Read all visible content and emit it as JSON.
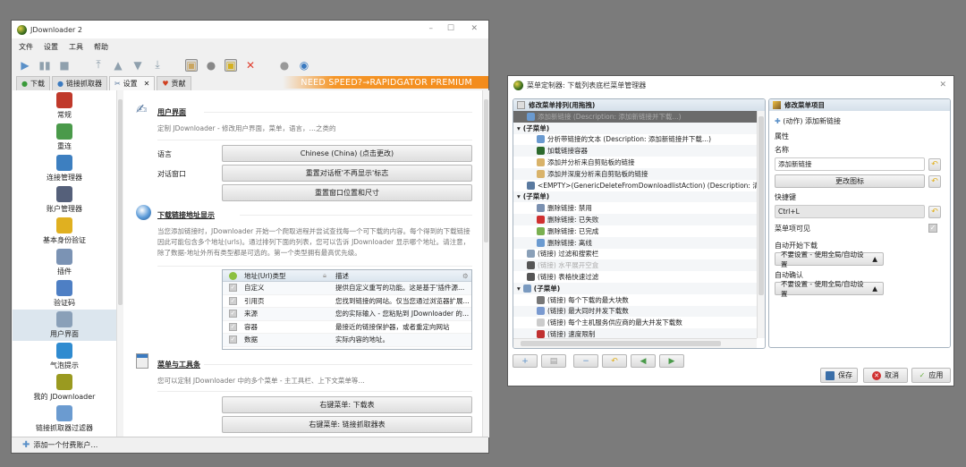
{
  "main_window": {
    "title": "JDownloader 2",
    "window_controls": [
      "–",
      "☐",
      "✕"
    ],
    "menu": [
      "文件",
      "设置",
      "工具",
      "帮助"
    ],
    "tabs": [
      {
        "label": "下载",
        "icon": "download-icon"
      },
      {
        "label": "链接抓取器",
        "icon": "linkgrabber-icon"
      },
      {
        "label": "设置",
        "icon": "settings-icon",
        "closable": true,
        "close": "✕"
      },
      {
        "label": "贡献",
        "icon": "heart-icon"
      }
    ],
    "promo": "NEED SPEED?→RAPIDGATOR PREMIUM",
    "sidebar": [
      {
        "label": "常规",
        "color": "#c0392b"
      },
      {
        "label": "重连",
        "color": "#4a9a4a"
      },
      {
        "label": "连接管理器",
        "color": "#3d7fc0"
      },
      {
        "label": "账户管理器",
        "color": "#55607a"
      },
      {
        "label": "基本身份验证",
        "color": "#e0b020"
      },
      {
        "label": "插件",
        "color": "#7b93b4"
      },
      {
        "label": "验证码",
        "color": "#4e7fc4"
      },
      {
        "label": "用户界面",
        "color": "#8aa0b8",
        "selected": true
      },
      {
        "label": "气泡提示",
        "color": "#2f8bd0"
      },
      {
        "label": "我的 JDownloader",
        "color": "#9a9a20"
      },
      {
        "label": "链接抓取器过滤器",
        "color": "#6b9bd0"
      }
    ],
    "ui_section": {
      "title": "用户界面",
      "desc": "定制 JDownloader - 修改用户界面，菜单，语言，…之类的",
      "language_label": "语言",
      "language_value": "Chinese (China) (点击更改)",
      "dialog_label": "对话窗口",
      "reset_dialog": "重置对话框'不再显示'标志",
      "reset_window": "重置窗口位置和尺寸"
    },
    "url_section": {
      "title": "下载链接地址显示",
      "desc": "当您添加链接时，JDownloader 开始一个爬取进程并尝试查找每一个可下载的内容。每个得到的下载链接因此可能包含多个地址(urls)。通过排列下面的列表，您可以告诉 JDownloader 显示哪个地址。请注意，除了数据-地址外所有类型都是可选的。第一个类型拥有最高优先级。",
      "columns": [
        "地址(Url)类型",
        "描述"
      ],
      "rows": [
        {
          "type": "自定义",
          "desc": "提供自定义重写的功能。这是基于'插件源..."
        },
        {
          "type": "引用页",
          "desc": "您找到链接的网站。仅当您通过浏览器扩展..."
        },
        {
          "type": "来源",
          "desc": "您的实际输入 - 您粘贴到 JDownloader 的..."
        },
        {
          "type": "容器",
          "desc": "最接近的链接保护器，或者重定向网站"
        },
        {
          "type": "数据",
          "desc": "实际内容的地址。"
        }
      ]
    },
    "menu_section": {
      "title": "菜单与工具条",
      "desc": "您可以定制 JDownloader 中的多个菜单 - 主工具栏、上下文菜单等…",
      "btn1": "右键菜单: 下载表",
      "btn2": "右键菜单: 链接抓取器表"
    },
    "status": "添加一个付费账户…"
  },
  "dialog": {
    "title": "菜单定制器: 下载列表底栏菜单管理器",
    "close": "✕",
    "left_header": "修改菜单排列(用拖拽)",
    "tree": [
      {
        "label": "添加新链接 (Description: 添加新链接并下载...)",
        "level": 1,
        "icon": "#6a9ad0",
        "selected": true
      },
      {
        "label": "(子菜单)",
        "level": 0,
        "expander": true
      },
      {
        "label": "分析带链接的文本 (Description: 添加新链接并下载...)",
        "level": 2,
        "icon": "#6a9ad0"
      },
      {
        "label": "加载链接容器",
        "level": 2,
        "icon": "#2d6a2d"
      },
      {
        "label": "添加并分析来自剪贴板的链接",
        "level": 2,
        "icon": "#d9b36a"
      },
      {
        "label": "添加并深度分析来自剪贴板的链接",
        "level": 2,
        "icon": "#d9b36a"
      },
      {
        "label": "<EMPTY>(GenericDeleteFromDownloadlistAction) (Description: 清除下",
        "level": 1,
        "icon": "#5a7aa0"
      },
      {
        "label": "(子菜单)",
        "level": 0,
        "expander": true
      },
      {
        "label": "删除链接: 禁用",
        "level": 2,
        "icon": "#7a90b0"
      },
      {
        "label": "删除链接: 已失败",
        "level": 2,
        "icon": "#d03030"
      },
      {
        "label": "删除链接: 已完成",
        "level": 2,
        "icon": "#7ab050"
      },
      {
        "label": "删除链接: 离线",
        "level": 2,
        "icon": "#6a9ad0"
      },
      {
        "label": "(链接) 过滤和搜索栏",
        "level": 1,
        "icon": "#8aa0b8"
      },
      {
        "label": "(链接) 水平展开空盒",
        "level": 1,
        "icon": "#555",
        "disabled": true
      },
      {
        "label": "(链接) 表格快速过滤",
        "level": 1,
        "icon": "#555"
      },
      {
        "label": "(子菜单)",
        "level": 0,
        "expander": true,
        "icon": "#7a9ac0"
      },
      {
        "label": "(链接) 每个下载的最大块数",
        "level": 2,
        "icon": "#777"
      },
      {
        "label": "(链接) 最大同时并发下载数",
        "level": 2,
        "icon": "#7a9ad0"
      },
      {
        "label": "(链接) 每个主机服务供应商的最大并发下载数",
        "level": 2,
        "icon": "#ccc"
      },
      {
        "label": "(链接) 速度限制",
        "level": 2,
        "icon": "#c03030"
      }
    ],
    "tool_buttons": [
      "+",
      "▤",
      "−",
      "↶",
      "◀",
      "▶"
    ],
    "right_header": "修改菜单项目",
    "action": "(动作) 添加新链接",
    "properties_label": "属性",
    "name_label": "名称",
    "name_value": "添加新链接",
    "change_icon": "更改图标",
    "shortcut_label": "快捷键",
    "shortcut_value": "Ctrl+L",
    "visible_label": "菜单项可见",
    "visible_checked": true,
    "autostart_label": "自动开始下载",
    "autostart_value": "不要设置 - 使用全局/自动设置",
    "autoconfirm_label": "自动确认",
    "autoconfirm_value": "不要设置 - 使用全局/自动设置",
    "save": "保存",
    "cancel": "取消",
    "apply": "应用"
  }
}
